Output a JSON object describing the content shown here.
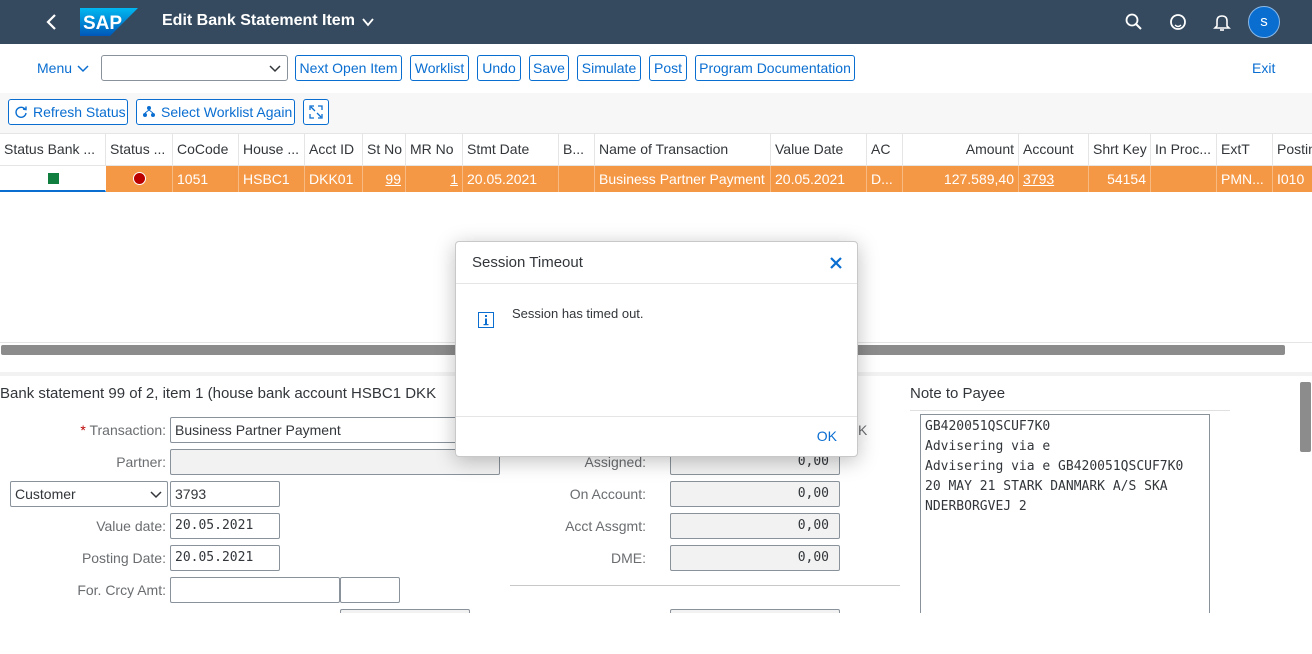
{
  "shell": {
    "logo": "SAP",
    "title": "Edit Bank Statement Item",
    "avatar": "s",
    "icons": [
      "back-icon",
      "title-chevron-icon",
      "search-icon",
      "help-icon",
      "notifications-icon"
    ]
  },
  "toolbar": {
    "menu_label": "Menu",
    "combo_value": "",
    "next_open_item": "Next Open Item",
    "worklist": "Worklist",
    "undo": "Undo",
    "save": "Save",
    "simulate": "Simulate",
    "post": "Post",
    "program_documentation": "Program Documentation",
    "exit": "Exit"
  },
  "actions": {
    "refresh_status": "Refresh Status",
    "select_worklist_again": "Select Worklist Again"
  },
  "table": {
    "headers": [
      "Status Bank ...",
      "Status ...",
      "CoCode",
      "House ...",
      "Acct ID",
      "St No",
      "MR No",
      "Stmt Date",
      "B...",
      "Name of Transaction",
      "Value Date",
      "AC",
      "Amount",
      "Account",
      "Shrt Key",
      "In Proc...",
      "ExtT",
      "Postin"
    ],
    "rows": [
      [
        "",
        "",
        "1051",
        "HSBC1",
        "DKK01",
        "99",
        "1",
        "20.05.2021",
        "",
        "Business Partner Payment",
        "20.05.2021",
        "D...",
        "127.589,40",
        "3793",
        "54154",
        "",
        "PMN...",
        "I010"
      ]
    ]
  },
  "form": {
    "title": "Bank statement 99 of 2, item 1 (house bank account HSBC1 DKK",
    "transaction_label": "Transaction:",
    "transaction_required": "*",
    "transaction_value": "Business Partner Payment",
    "partner_label": "Partner:",
    "partner_value": "",
    "partner_type": "Customer",
    "partner_number": "3793",
    "value_date_label": "Value date:",
    "value_date": "20.05.2021",
    "posting_date_label": "Posting Date:",
    "posting_date": "20.05.2021",
    "for_crcy_label": "For. Crcy Amt:",
    "for_crcy_value": "",
    "for_crcy_unit": "",
    "currency_fragment": "K",
    "assigned_label": "Assigned:",
    "assigned_value": "0,00",
    "on_account_label": "On Account:",
    "on_account_value": "0,00",
    "acct_assgmt_label": "Acct Assgmt:",
    "acct_assgmt_value": "0,00",
    "dme_label": "DME:",
    "dme_value": "0,00"
  },
  "note": {
    "title": "Note to Payee",
    "text": "GB420051QSCUF7K0\nAdvisering via e\nAdvisering via e GB420051QSCUF7K0\n20 MAY 21 STARK DANMARK A/S SKA\nNDERBORGVEJ 2"
  },
  "dialog": {
    "title": "Session Timeout",
    "message": "Session has timed out.",
    "ok": "OK"
  },
  "colors": {
    "shell": "#354a5f",
    "accent": "#0a6ed1",
    "selected_row": "#f59845",
    "status_green": "#107e3e",
    "status_red": "#bb0000"
  }
}
